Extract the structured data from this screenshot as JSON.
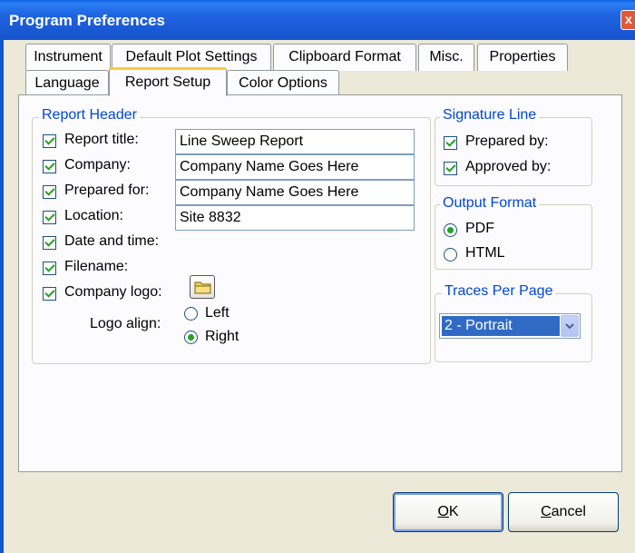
{
  "window": {
    "title": "Program Preferences",
    "close_glyph": "x"
  },
  "tabs_row1": [
    "Instrument",
    "Default Plot Settings",
    "Clipboard Format",
    "Misc.",
    "Properties"
  ],
  "tabs_row2": [
    "Language",
    "Report Setup",
    "Color Options"
  ],
  "active_tab": "Report Setup",
  "report_header": {
    "title": "Report Header",
    "report_title_label": "Report title:",
    "report_title_value": "Line Sweep Report",
    "company_label": "Company:",
    "company_value": "Company Name Goes Here",
    "prepared_for_label": "Prepared for:",
    "prepared_for_value": "Company Name Goes Here",
    "location_label": "Location:",
    "location_value": "Site 8832",
    "date_time_label": "Date and time:",
    "filename_label": "Filename:",
    "company_logo_label": "Company logo:",
    "logo_align_label": "Logo align:",
    "align_left": "Left",
    "align_right": "Right",
    "selected_align": "Right"
  },
  "signature_line": {
    "title": "Signature Line",
    "prepared_by": "Prepared by:",
    "approved_by": "Approved by:"
  },
  "output_format": {
    "title": "Output Format",
    "pdf": "PDF",
    "html": "HTML",
    "selected": "PDF"
  },
  "traces_per_page": {
    "title": "Traces Per Page",
    "selected": "2 - Portrait"
  },
  "buttons": {
    "ok_mnemonic": "O",
    "ok_rest": "K",
    "cancel_mnemonic": "C",
    "cancel_rest": "ancel"
  },
  "colors": {
    "titlebar": "#1552cc",
    "group_title": "#0046d5",
    "check_mark": "#21a121",
    "active_tab_accent": "#ffc83c"
  }
}
